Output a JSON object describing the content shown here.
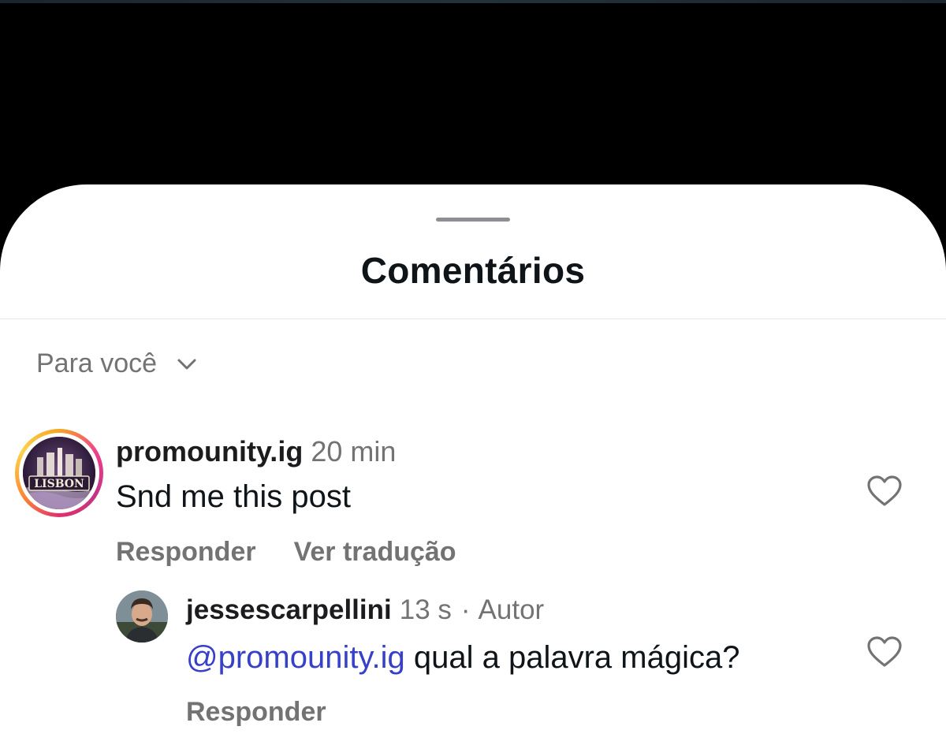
{
  "sheet": {
    "title": "Comentários"
  },
  "sort": {
    "label": "Para você",
    "icon": "chevron-down-icon"
  },
  "comments": [
    {
      "username": "promounity.ig",
      "time": "20 min",
      "text": "Snd me this post",
      "actions": {
        "reply": "Responder",
        "translate": "Ver tradução"
      },
      "avatar": {
        "logo_text": "LISBON"
      },
      "like_icon": "heart-icon"
    }
  ],
  "replies": [
    {
      "username": "jessescarpellini",
      "time": "13 s",
      "separator": "·",
      "badge": "Autor",
      "mention": "@promounity.ig",
      "text": " qual a palavra mágica?",
      "actions": {
        "reply": "Responder"
      },
      "like_icon": "heart-icon"
    }
  ],
  "colors": {
    "background": "#000000",
    "sheet": "#ffffff",
    "text_primary": "#0f1419",
    "text_secondary": "#737373",
    "mention": "#3740c8"
  }
}
